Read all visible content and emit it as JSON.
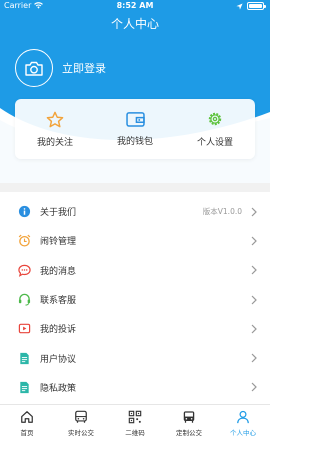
{
  "status_bar": {
    "carrier": "Carrier",
    "time": "8:52 AM"
  },
  "nav": {
    "title": "个人中心"
  },
  "login": {
    "label": "立即登录",
    "avatar_icon": "camera-icon"
  },
  "quick_actions": [
    {
      "label": "我的关注",
      "icon": "star-icon",
      "color": "#f2a33a"
    },
    {
      "label": "我的钱包",
      "icon": "wallet-icon",
      "color": "#2a8fe0"
    },
    {
      "label": "个人设置",
      "icon": "settings-gear-icon",
      "color": "#5cc23b"
    }
  ],
  "menu": [
    {
      "label": "关于我们",
      "extra": "版本V1.0.0",
      "icon": "info-icon",
      "color": "#2a8fe0"
    },
    {
      "label": "闹铃管理",
      "extra": "",
      "icon": "alarm-clock-icon",
      "color": "#f2a33a"
    },
    {
      "label": "我的消息",
      "extra": "",
      "icon": "message-icon",
      "color": "#e8453c"
    },
    {
      "label": "联系客服",
      "extra": "",
      "icon": "headset-icon",
      "color": "#4cb94a"
    },
    {
      "label": "我的投诉",
      "extra": "",
      "icon": "complaint-icon",
      "color": "#e8453c"
    },
    {
      "label": "用户协议",
      "extra": "",
      "icon": "document-icon",
      "color": "#2bb6a8"
    },
    {
      "label": "隐私政策",
      "extra": "",
      "icon": "document-icon",
      "color": "#2bb6a8"
    }
  ],
  "tabs": [
    {
      "label": "首页",
      "icon": "home-icon"
    },
    {
      "label": "实时公交",
      "icon": "bus-front-icon"
    },
    {
      "label": "二维码",
      "icon": "qrcode-icon"
    },
    {
      "label": "定制公交",
      "icon": "bus-icon"
    },
    {
      "label": "个人中心",
      "icon": "user-icon",
      "active": true
    }
  ],
  "colors": {
    "primary": "#1e9be6",
    "tab_active": "#1e9be6"
  }
}
